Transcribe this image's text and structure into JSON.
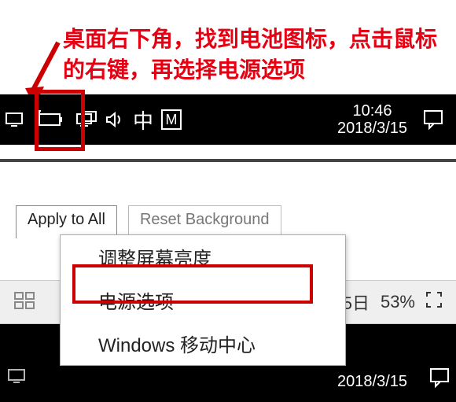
{
  "annotation": {
    "text": "桌面右下角，找到电池图标，点击鼠标的右键，再选择电源选项"
  },
  "taskbar1": {
    "time": "10:46",
    "date": "2018/3/15",
    "ime_zh": "中",
    "ime_m": "M"
  },
  "buttons": {
    "apply": "Apply to All",
    "reset": "Reset Background"
  },
  "context_menu": {
    "items": [
      "调整屏幕亮度",
      "电源选项",
      "Windows 移动中心"
    ]
  },
  "toolbar": {
    "right_date_fragment": "5日",
    "zoom": "53%"
  },
  "taskbar2": {
    "date": "2018/3/15"
  }
}
